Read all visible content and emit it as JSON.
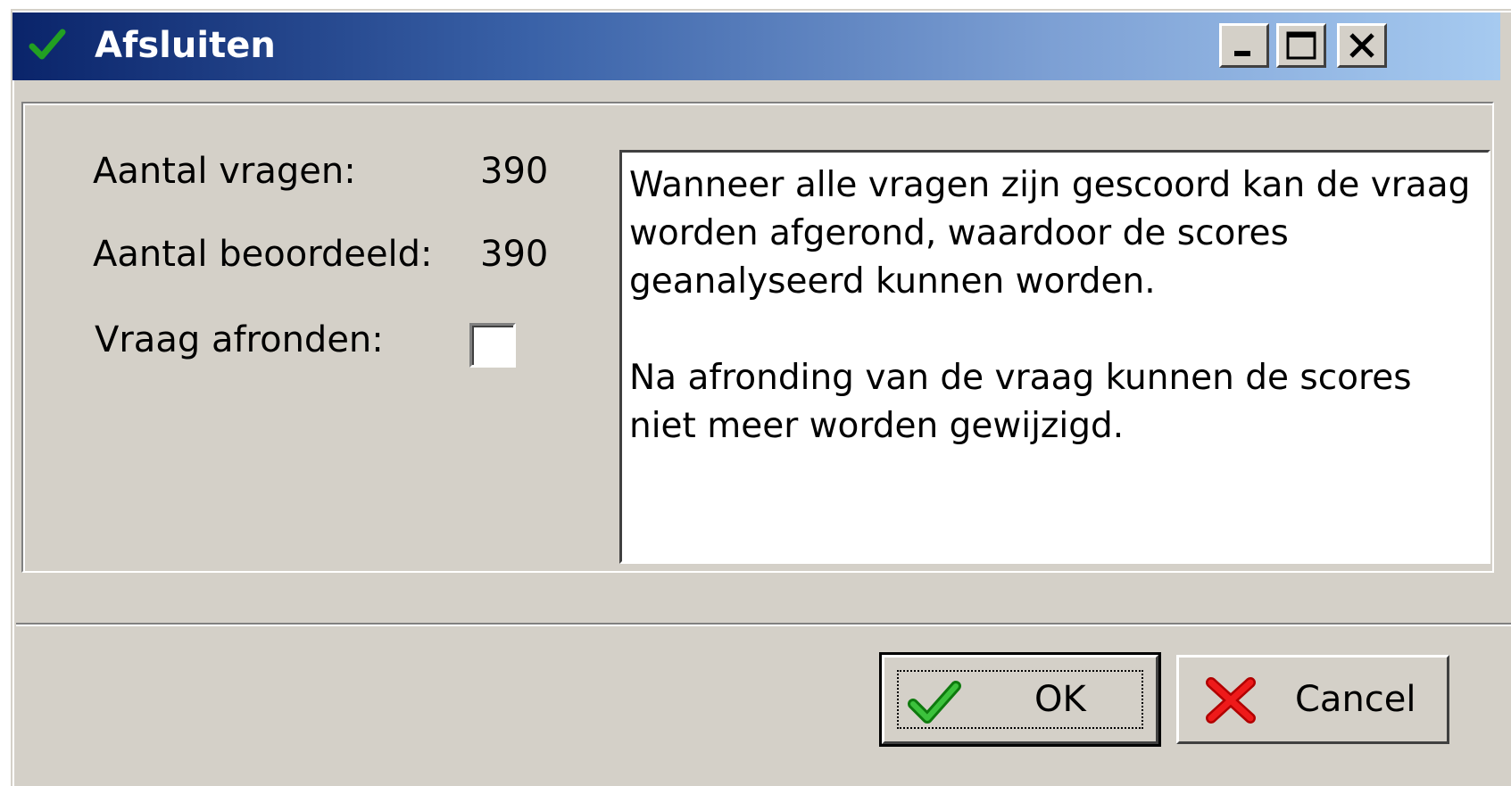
{
  "window": {
    "title": "Afsluiten",
    "title_icon": "green-check-icon",
    "controls": [
      "minimize-icon",
      "maximize-icon",
      "close-icon"
    ]
  },
  "form": {
    "aantal_vragen_label": "Aantal vragen:",
    "aantal_vragen_value": "390",
    "aantal_beoordeeld_label": "Aantal beoordeeld:",
    "aantal_beoordeeld_value": "390",
    "vraag_afronden_label": "Vraag afronden:",
    "vraag_afronden_checked": false
  },
  "memo": {
    "paragraph1": "Wanneer alle vragen zijn gescoord kan de vraag worden afgerond, waardoor de scores geanalyseerd kunnen worden.",
    "paragraph2": "Na afronding van de vraag kunnen de scores niet meer worden gewijzigd."
  },
  "buttons": {
    "ok_label": "OK",
    "ok_icon": "green-check-icon",
    "cancel_label": "Cancel",
    "cancel_icon": "red-x-icon"
  },
  "colors": {
    "titlebar_start": "#0a246a",
    "titlebar_end": "#a6caf0",
    "face": "#d4d0c8",
    "check_green": "#1f9a1f",
    "cancel_red": "#e01010"
  }
}
